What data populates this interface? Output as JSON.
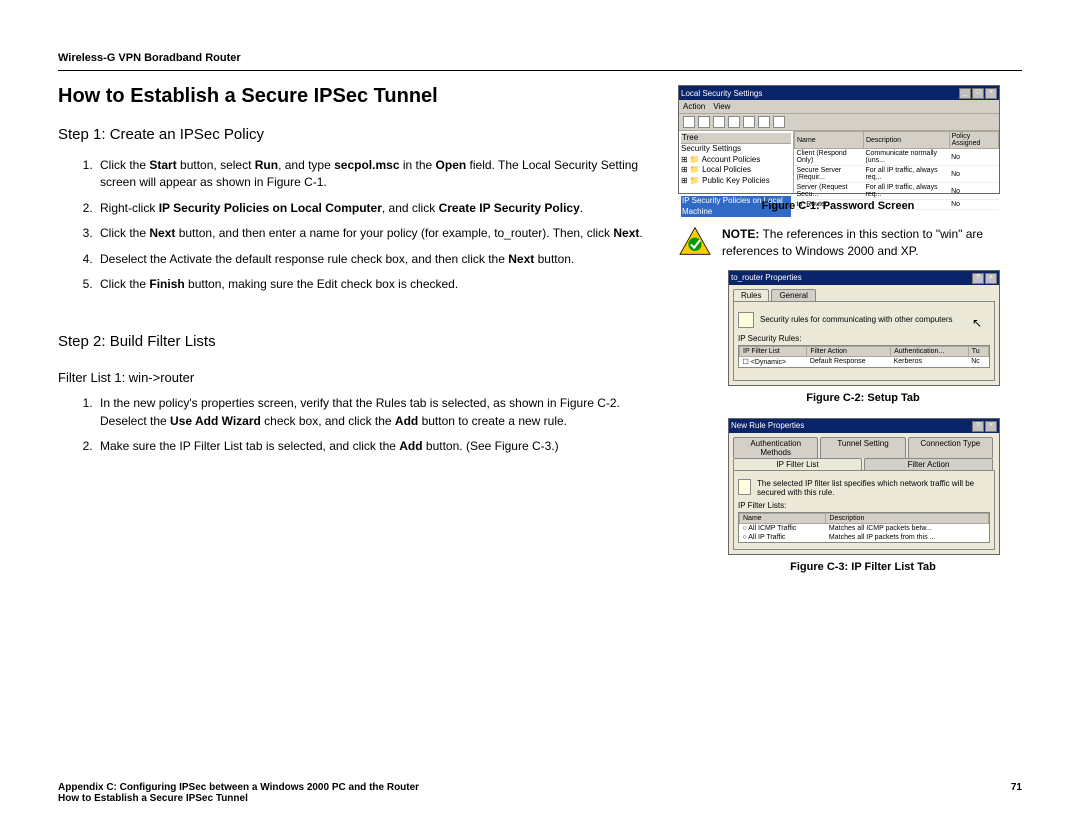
{
  "header": "Wireless-G VPN Boradband Router",
  "title": "How to Establish a Secure IPSec Tunnel",
  "step1": {
    "heading": "Step 1: Create an IPSec Policy",
    "items": [
      {
        "pre": "Click the ",
        "b1": "Start",
        "mid1": " button, select ",
        "b2": "Run",
        "mid2": ", and type ",
        "b3": "secpol.msc",
        "mid3": " in the ",
        "b4": "Open",
        "post": " field.  The Local Security Setting screen will appear as shown in Figure C-1."
      },
      {
        "pre": "Right-click ",
        "b1": "IP Security Policies on Local Computer",
        "mid1": ", and click ",
        "b2": "Create IP Security Policy",
        "post": "."
      },
      {
        "pre": "Click the ",
        "b1": "Next",
        "mid1": " button, and then enter a name for your policy (for example, to_router). Then, click ",
        "b2": "Next",
        "post": "."
      },
      {
        "pre": "Deselect the Activate the default response rule check box, and then click the ",
        "b1": "Next",
        "post": " button."
      },
      {
        "pre": "Click the ",
        "b1": "Finish",
        "post": " button, making sure the Edit check box is checked."
      }
    ]
  },
  "step2": {
    "heading": "Step 2: Build Filter Lists",
    "subheading": "Filter List 1: win->router",
    "items": [
      {
        "pre": "In the new policy's properties screen, verify that the Rules tab is selected, as shown in Figure C-2. Deselect the ",
        "b1": "Use Add Wizard",
        "mid1": " check box, and click the ",
        "b2": "Add",
        "post": " button to create a new rule."
      },
      {
        "pre": "Make sure the IP Filter List tab is selected, and click the ",
        "b1": "Add",
        "post": " button. (See Figure C-3.)"
      }
    ]
  },
  "note": {
    "label": "NOTE:",
    "text": "  The references in this section to \"win\" are references to Windows 2000 and XP."
  },
  "fig1": {
    "caption": "Figure C-1: Password Screen",
    "winTitle": "Local Security Settings",
    "menu": {
      "a": "Action",
      "b": "View"
    },
    "treeHeader": "Tree",
    "tree": [
      "Security Settings",
      "Account Policies",
      "Local Policies",
      "Public Key Policies",
      "IP Security Policies on Local Machine"
    ],
    "cols": {
      "name": "Name",
      "desc": "Description",
      "pa": "Policy Assigned"
    },
    "rows": [
      {
        "n": "Client (Respond Only)",
        "d": "Communicate normally (uns...",
        "p": "No"
      },
      {
        "n": "Secure Server (Requir...",
        "d": "For all IP traffic, always req...",
        "p": "No"
      },
      {
        "n": "Server (Request Secu...",
        "d": "For all IP traffic, always req...",
        "p": "No"
      },
      {
        "n": "to_Router",
        "d": "",
        "p": "No"
      }
    ]
  },
  "fig2": {
    "caption": "Figure C-2: Setup Tab",
    "winTitle": "to_router Properties",
    "tabs": {
      "a": "Rules",
      "b": "General"
    },
    "desc": "Security rules for communicating with other computers",
    "gridLabel": "IP Security Rules:",
    "cols": {
      "a": "IP Filter List",
      "b": "Filter Action",
      "c": "Authentication...",
      "d": "Tu"
    },
    "row": {
      "a": "<Dynamic>",
      "b": "Default Response",
      "c": "Kerberos",
      "d": "Nc"
    }
  },
  "fig3": {
    "caption": "Figure C-3: IP Filter List Tab",
    "winTitle": "New Rule Properties",
    "tabsTop": {
      "a": "Authentication Methods",
      "b": "Tunnel Setting",
      "c": "Connection Type"
    },
    "tabsBot": {
      "a": "IP Filter List",
      "b": "Filter Action"
    },
    "desc": "The selected IP filter list specifies which network traffic will be secured with this rule.",
    "gridLabel": "IP Filter Lists:",
    "cols": {
      "a": "Name",
      "b": "Description"
    },
    "rows": [
      {
        "a": "All ICMP Traffic",
        "b": "Matches all ICMP packets betw..."
      },
      {
        "a": "All IP Traffic",
        "b": "Matches all IP packets from this ..."
      }
    ]
  },
  "footer": {
    "left": "Appendix C: Configuring IPSec between a Windows 2000 PC and the Router",
    "page": "71",
    "sub": "How to Establish a Secure IPSec Tunnel"
  }
}
